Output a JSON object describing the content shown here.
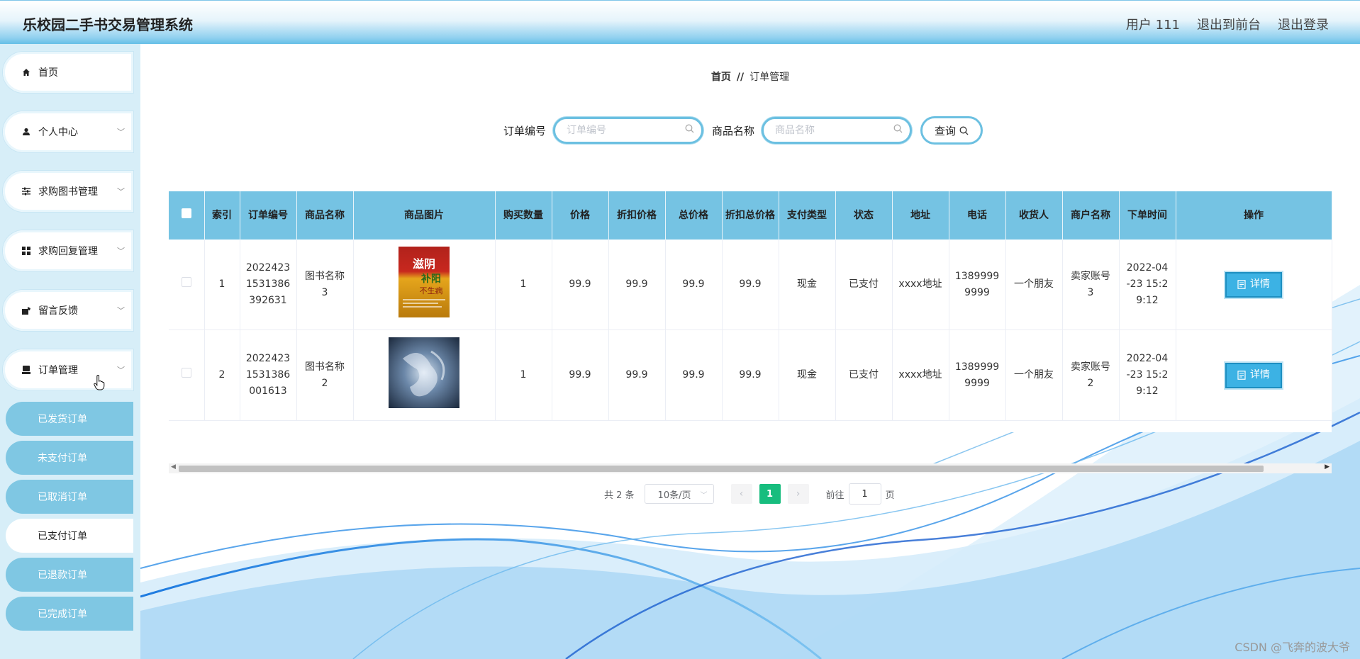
{
  "app": {
    "title": "乐校园二手书交易管理系统"
  },
  "header_links": {
    "user": "用户 111",
    "front": "退出到前台",
    "logout": "退出登录"
  },
  "sidebar": {
    "items": [
      {
        "label": "首页",
        "icon": "home-icon"
      },
      {
        "label": "个人中心",
        "icon": "user-icon"
      },
      {
        "label": "求购图书管理",
        "icon": "sliders-icon"
      },
      {
        "label": "求购回复管理",
        "icon": "grid-icon"
      },
      {
        "label": "留言反馈",
        "icon": "feedback-icon"
      },
      {
        "label": "订单管理",
        "icon": "order-icon"
      }
    ],
    "sub_items": [
      {
        "label": "已发货订单"
      },
      {
        "label": "未支付订单"
      },
      {
        "label": "已取消订单"
      },
      {
        "label": "已支付订单",
        "active": true
      },
      {
        "label": "已退款订单"
      },
      {
        "label": "已完成订单"
      }
    ]
  },
  "breadcrumb": {
    "home": "首页",
    "sep": "//",
    "current": "订单管理"
  },
  "search": {
    "order_label": "订单编号",
    "order_placeholder": "订单编号",
    "order_value": "",
    "goods_label": "商品名称",
    "goods_placeholder": "商品名称",
    "goods_value": "",
    "button": "查询"
  },
  "table": {
    "headers": [
      "索引",
      "订单编号",
      "商品名称",
      "商品图片",
      "购买数量",
      "价格",
      "折扣价格",
      "总价格",
      "折扣总价格",
      "支付类型",
      "状态",
      "地址",
      "电话",
      "收货人",
      "商户名称",
      "下单时间",
      "操作"
    ],
    "rows": [
      {
        "index": "1",
        "order_no": "20224231531386392631",
        "goods": "图书名称3",
        "qty": "1",
        "price": "99.9",
        "discount_price": "99.9",
        "total": "99.9",
        "discount_total": "99.9",
        "pay_type": "现金",
        "status": "已支付",
        "address": "xxxx地址",
        "phone": "13899999999",
        "receiver": "一个朋友",
        "merchant": "卖家账号3",
        "time": "2022-04-23 15:29:12",
        "action": "详情",
        "cover_title": "滋阴",
        "cover_sub": "补阳",
        "cover_tail": "不生病"
      },
      {
        "index": "2",
        "order_no": "20224231531386001613",
        "goods": "图书名称2",
        "qty": "1",
        "price": "99.9",
        "discount_price": "99.9",
        "total": "99.9",
        "discount_total": "99.9",
        "pay_type": "现金",
        "status": "已支付",
        "address": "xxxx地址",
        "phone": "13899999999",
        "receiver": "一个朋友",
        "merchant": "卖家账号2",
        "time": "2022-04-23 15:29:12",
        "action": "详情"
      }
    ]
  },
  "pagination": {
    "total": "共 2 条",
    "page_size": "10条/页",
    "current": "1",
    "goto": "前往",
    "goto_value": "1",
    "page_unit": "页"
  },
  "watermark": "CSDN @飞奔的波大爷",
  "colors": {
    "header_accent": "#5fbde6",
    "table_header": "#75c3e3",
    "detail_button": "#3cb2e4",
    "active_page": "#17bd7e",
    "sub_menu": "#7fc7e3"
  }
}
